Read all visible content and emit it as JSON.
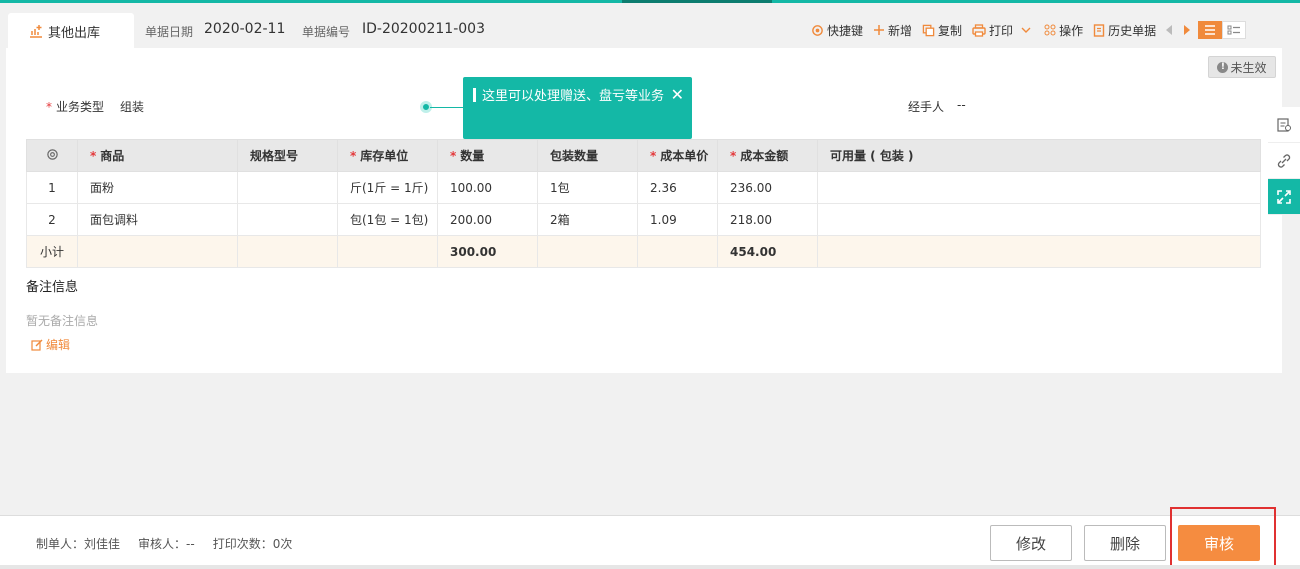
{
  "header": {
    "tab_label": "其他出库",
    "date_label": "单据日期",
    "date_value": "2020-02-11",
    "number_label": "单据编号",
    "number_value": "ID-20200211-003"
  },
  "toolbar": {
    "shortcut": "快捷键",
    "add": "新增",
    "copy": "复制",
    "print": "打印",
    "operate": "操作",
    "history": "历史单据"
  },
  "status_badge": "未生效",
  "form": {
    "biz_type_label": "业务类型",
    "biz_type_value": "组装",
    "handler_label": "经手人",
    "handler_value": "--"
  },
  "tooltip": {
    "text": "这里可以处理赠送、盘亏等业务",
    "close": "✕"
  },
  "table": {
    "columns": [
      "商品",
      "规格型号",
      "库存单位",
      "数量",
      "包装数量",
      "成本单价",
      "成本金额",
      "可用量 ( 包装 )"
    ],
    "rows": [
      {
        "idx": "1",
        "product": "面粉",
        "spec": "",
        "unit": "斤(1斤 = 1斤)",
        "qty": "100.00",
        "pack_qty": "1包",
        "unit_cost": "2.36",
        "amount": "236.00",
        "available": ""
      },
      {
        "idx": "2",
        "product": "面包调料",
        "spec": "",
        "unit": "包(1包 = 1包)",
        "qty": "200.00",
        "pack_qty": "2箱",
        "unit_cost": "1.09",
        "amount": "218.00",
        "available": ""
      }
    ],
    "subtotal": {
      "label": "小计",
      "qty": "300.00",
      "amount": "454.00"
    }
  },
  "notes": {
    "title": "备注信息",
    "empty": "暂无备注信息",
    "edit": "编辑"
  },
  "footer": {
    "maker": "制单人：刘佳佳",
    "reviewer": "审核人：--",
    "print_count": "打印次数：0次",
    "modify": "修改",
    "delete": "删除",
    "audit": "审核"
  },
  "colors": {
    "accent": "#14b8a6",
    "primary": "#f58c40",
    "highlight": "#e03131"
  }
}
